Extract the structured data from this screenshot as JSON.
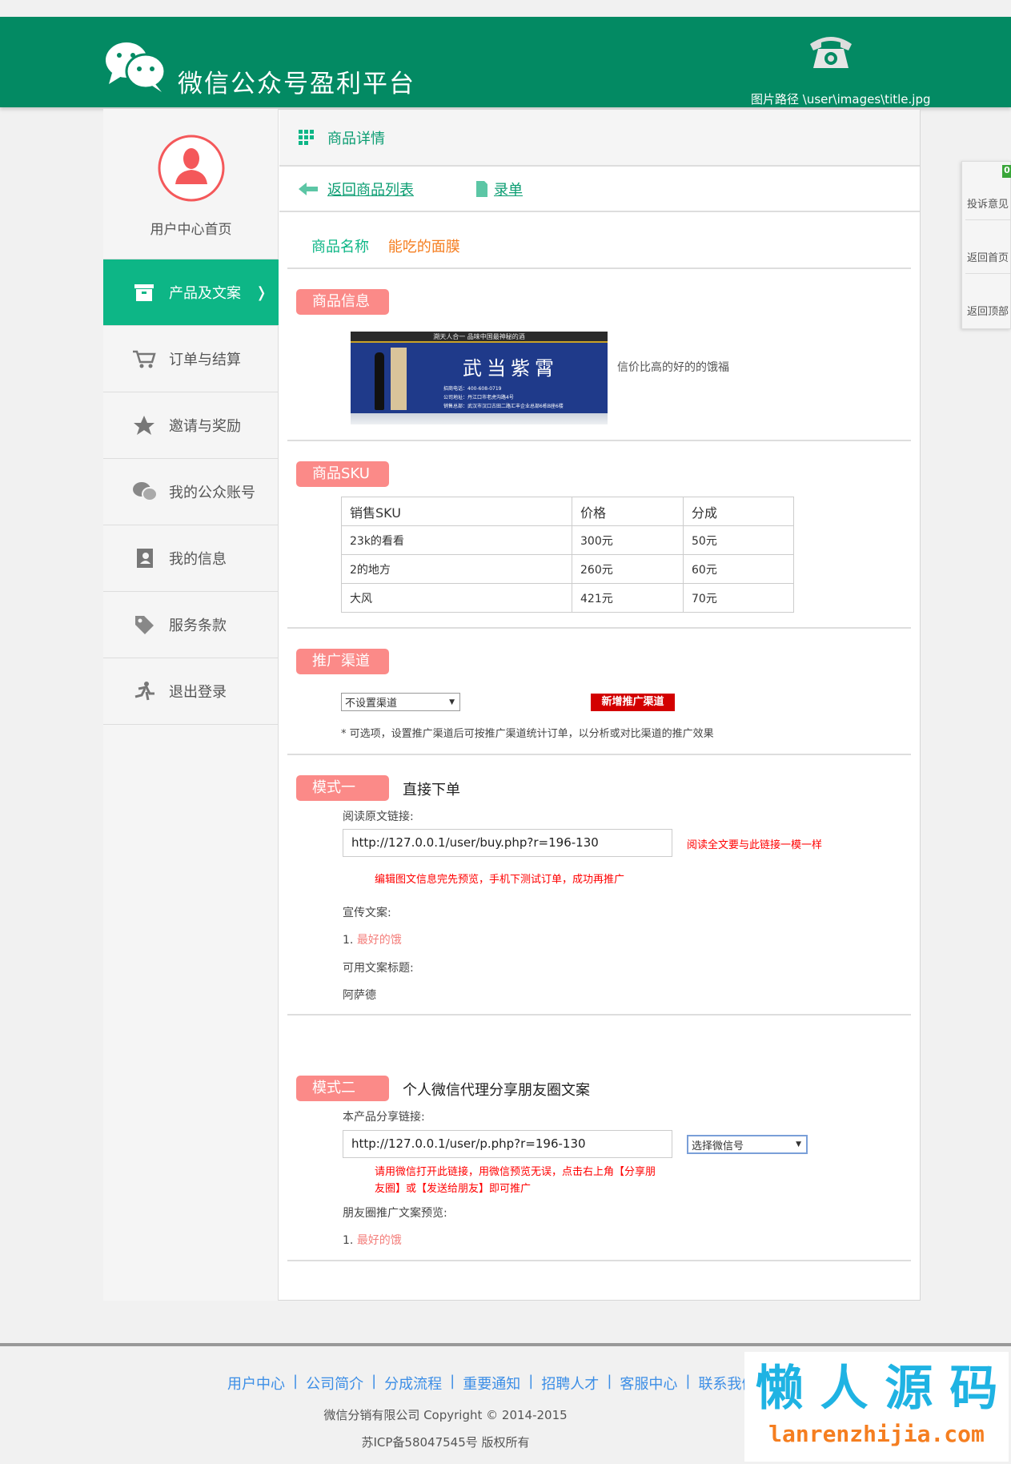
{
  "header": {
    "title": "微信公众号盈利平台",
    "phone_caption": "图片路径 \\user\\images\\title.jpg"
  },
  "sidebar": {
    "user_home": "用户中心首页",
    "items": [
      {
        "label": "产品及文案",
        "icon": "archive-icon",
        "active": true,
        "arrow": "❭"
      },
      {
        "label": "订单与结算",
        "icon": "cart-icon"
      },
      {
        "label": "邀请与奖励",
        "icon": "star-icon"
      },
      {
        "label": "我的公众账号",
        "icon": "wechat-icon"
      },
      {
        "label": "我的信息",
        "icon": "contacts-icon"
      },
      {
        "label": "服务条款",
        "icon": "tag-icon"
      },
      {
        "label": "退出登录",
        "icon": "runner-icon"
      }
    ]
  },
  "main": {
    "title": "商品详情",
    "back_link": "返回商品列表",
    "order_link": "录单",
    "product_name_label": "商品名称",
    "product_name": "能吃的面膜",
    "info": {
      "badge": "商品信息",
      "description": "信价比高的好的的饿福",
      "banner": {
        "slogan": "溯天人合一    品味中国最神秘的酒",
        "brand": "武当紫霄",
        "lines": [
          "招商电话：400-608-0719",
          "公司地址：丹江口市老虎沟路4号",
          "销售总部：武汉市汉口古田二路汇丰企业总部6栋B座6楼"
        ]
      }
    },
    "sku": {
      "badge": "商品SKU",
      "headers": [
        "销售SKU",
        "价格",
        "分成"
      ],
      "rows": [
        [
          "23k的看看",
          "300元",
          "50元"
        ],
        [
          "2的地方",
          "260元",
          "60元"
        ],
        [
          "大风",
          "421元",
          "70元"
        ]
      ]
    },
    "channel": {
      "badge": "推广渠道",
      "select_value": "不设置渠道",
      "add_button": "新增推广渠道",
      "note": "* 可选项，设置推广渠道后可按推广渠道统计订单，以分析或对比渠道的推广效果"
    },
    "mode1": {
      "badge": "模式一",
      "title": "直接下单",
      "link_label": "阅读原文链接:",
      "link": "http://127.0.0.1/user/buy.php?r=196-130",
      "link_note": "阅读全文要与此链接一模一样",
      "tip": "编辑图文信息完先预览，手机下测试订单，成功再推广",
      "copy_label": "宣传文案:",
      "copy_num": "1.",
      "copy_text": "最好的饿",
      "title_label": "可用文案标题:",
      "title_value": "阿萨德"
    },
    "mode2": {
      "badge": "模式二",
      "title": "个人微信代理分享朋友圈文案",
      "link_label": "本产品分享链接:",
      "link": "http://127.0.0.1/user/p.php?r=196-130",
      "select_value": "选择微信号",
      "tip1": "请用微信打开此链接，用微信预览无误，点击右上角【分享朋",
      "tip2": "友圈】或【发送给朋友】即可推广",
      "preview_label": "朋友圈推广文案预览:",
      "copy_num": "1.",
      "copy_text": "最好的饿"
    }
  },
  "right_panel": {
    "badge": "0",
    "items": [
      "投诉意见",
      "返回首页",
      "返回顶部"
    ]
  },
  "footer": {
    "links": [
      "用户中心",
      "公司简介",
      "分成流程",
      "重要通知",
      "招聘人才",
      "客服中心",
      "联系我们"
    ],
    "copyright": "微信分销有限公司   Copyright © 2014-2015",
    "icp": "苏ICP备58047545号 版权所有"
  },
  "watermark": {
    "cn": "懒 人 源 码",
    "en": "lanrenzhijia.com"
  },
  "colors": {
    "header": "#038a63",
    "accent": "#0db686",
    "badge": "#fb8a88",
    "orange": "#f57e20",
    "red": "#d30000",
    "link": "#3c8ee6"
  }
}
